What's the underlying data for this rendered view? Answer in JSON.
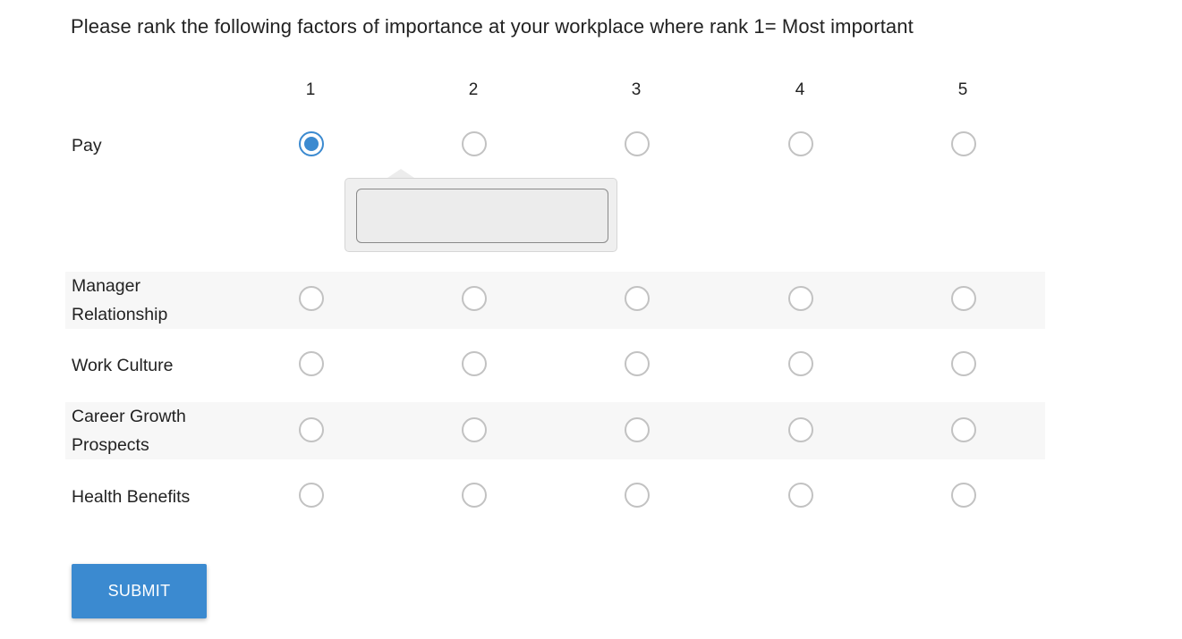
{
  "question": "Please rank the following factors of importance at your workplace where rank 1= Most important",
  "columns": [
    "1",
    "2",
    "3",
    "4",
    "5"
  ],
  "rows": [
    {
      "label_lines": [
        "Pay"
      ],
      "selected": "1"
    },
    {
      "label_lines": [
        "Manager",
        "Relationship"
      ],
      "selected": null
    },
    {
      "label_lines": [
        "Work Culture"
      ],
      "selected": null
    },
    {
      "label_lines": [
        "Career Growth",
        "Prospects"
      ],
      "selected": null
    },
    {
      "label_lines": [
        "Health Benefits"
      ],
      "selected": null
    }
  ],
  "popover": {
    "input_value": "",
    "input_placeholder": ""
  },
  "submit_label": "SUBMIT",
  "colors": {
    "accent": "#3b8ad0",
    "row_stripe": "#f7f7f7",
    "radio_border": "#c2c2c2"
  }
}
